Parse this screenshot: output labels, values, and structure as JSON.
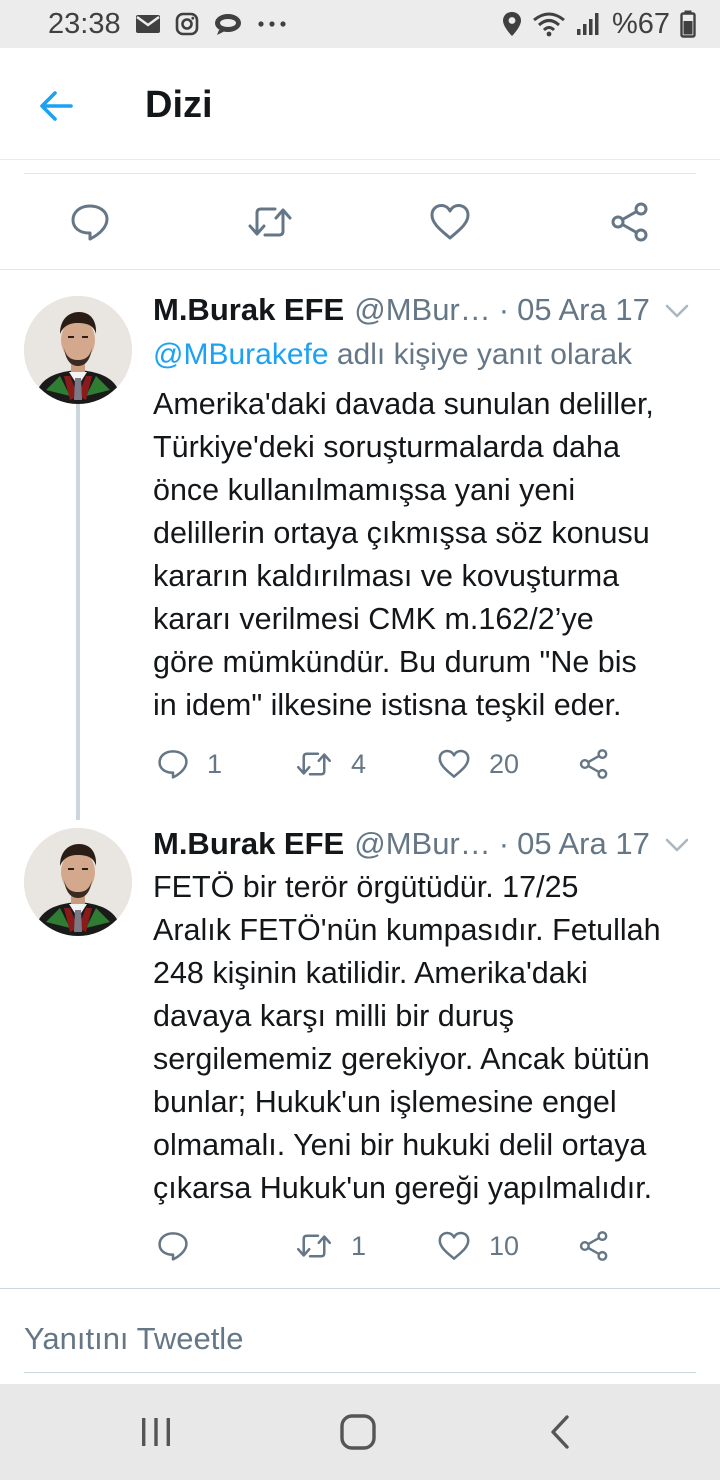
{
  "status_bar": {
    "time": "23:38",
    "battery": "%67",
    "left_icons": [
      "mail-icon",
      "instagram-icon",
      "chat-bubble-icon",
      "more-dots-icon"
    ],
    "right_icons": [
      "location-icon",
      "wifi-icon",
      "signal-icon",
      "battery-icon"
    ]
  },
  "header": {
    "title": "Dizi"
  },
  "tweets": [
    {
      "name": "M.Burak EFE",
      "handle": "@MBur…",
      "separator": "·",
      "date": "05 Ara 17",
      "reply_prefix_mention": "@MBurakefe",
      "reply_suffix": " adlı kişiye yanıt olarak",
      "text": "Amerika'daki davada sunulan deliller,\nTürkiye'deki soruşturmalarda daha\nönce kullanılmamışsa yani  yeni\ndelillerin ortaya çıkmışsa söz konusu\nkararın kaldırılması ve kovuşturma\nkararı verilmesi CMK m.162/2’ye\ngöre mümkündür. Bu durum \"Ne bis\nin idem\" ilkesine istisna teşkil eder.",
      "replies": "1",
      "retweets": "4",
      "likes": "20"
    },
    {
      "name": "M.Burak EFE",
      "handle": "@MBur…",
      "separator": "·",
      "date": "05 Ara 17",
      "text": "FETÖ bir terör örgütüdür. 17/25\nAralık FETÖ'nün kumpasıdır. Fetullah\n248 kişinin katilidir. Amerika'daki\ndavaya karşı milli bir duruş\nsergilememiz gerekiyor. Ancak bütün\nbunlar; Hukuk'un işlemesine engel\nolmamalı. Yeni bir hukuki delil ortaya\nçıkarsa Hukuk'un gereği yapılmalıdır.",
      "replies": "",
      "retweets": "1",
      "likes": "10"
    }
  ],
  "reply_box": {
    "placeholder": "Yanıtını Tweetle"
  },
  "colors": {
    "accent": "#1da1f2",
    "text": "#14171a",
    "secondary": "#657786",
    "divider": "#e1e8ed"
  }
}
